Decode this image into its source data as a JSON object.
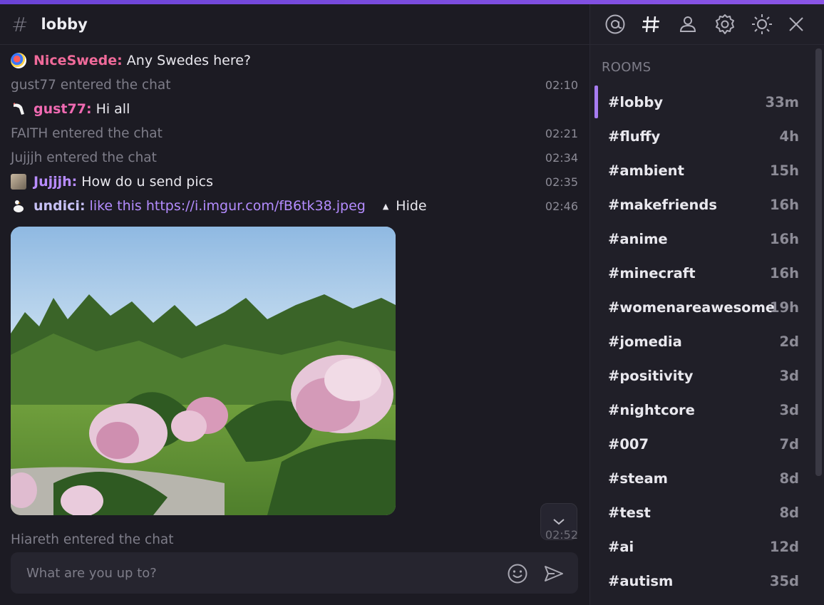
{
  "header": {
    "channel": "lobby"
  },
  "messages": [
    {
      "type": "user",
      "name": "NiceSwede:",
      "text": "Any Swedes here?",
      "time": ""
    },
    {
      "type": "system",
      "text": "gust77 entered the chat",
      "time": "02:10"
    },
    {
      "type": "user",
      "name": "gust77:",
      "text": "Hi all",
      "time": ""
    },
    {
      "type": "system",
      "text": "FAITH entered the chat",
      "time": "02:21"
    },
    {
      "type": "system",
      "text": "Jujjjh entered the chat",
      "time": "02:34"
    },
    {
      "type": "user",
      "name": "Jujjjh:",
      "text": "How do u send pics",
      "time": "02:35"
    },
    {
      "type": "user",
      "name": "undici:",
      "text": "like this",
      "link": "https://i.imgur.com/fB6tk38.jpeg",
      "hide_label": "Hide",
      "time": "02:46"
    }
  ],
  "last_system": {
    "text": "Hiareth entered the chat",
    "time": "02:52"
  },
  "composer": {
    "placeholder": "What are you up to?"
  },
  "sidebar": {
    "rooms_label": "ROOMS",
    "rooms": [
      {
        "name": "#lobby",
        "age": "33m"
      },
      {
        "name": "#fluffy",
        "age": "4h"
      },
      {
        "name": "#ambient",
        "age": "15h"
      },
      {
        "name": "#makefriends",
        "age": "16h"
      },
      {
        "name": "#anime",
        "age": "16h"
      },
      {
        "name": "#minecraft",
        "age": "16h"
      },
      {
        "name": "#womenareawesome",
        "age": "19h"
      },
      {
        "name": "#jomedia",
        "age": "2d"
      },
      {
        "name": "#positivity",
        "age": "3d"
      },
      {
        "name": "#nightcore",
        "age": "3d"
      },
      {
        "name": "#007",
        "age": "7d"
      },
      {
        "name": "#steam",
        "age": "8d"
      },
      {
        "name": "#test",
        "age": "8d"
      },
      {
        "name": "#ai",
        "age": "12d"
      },
      {
        "name": "#autism",
        "age": "35d"
      }
    ]
  },
  "icons": [
    "at-icon",
    "hash-icon",
    "user-icon",
    "gear-icon",
    "sun-icon",
    "close-icon"
  ],
  "colors": {
    "accent": "#a77cf0",
    "background": "#1c1b23",
    "sidebar": "#201f28"
  }
}
